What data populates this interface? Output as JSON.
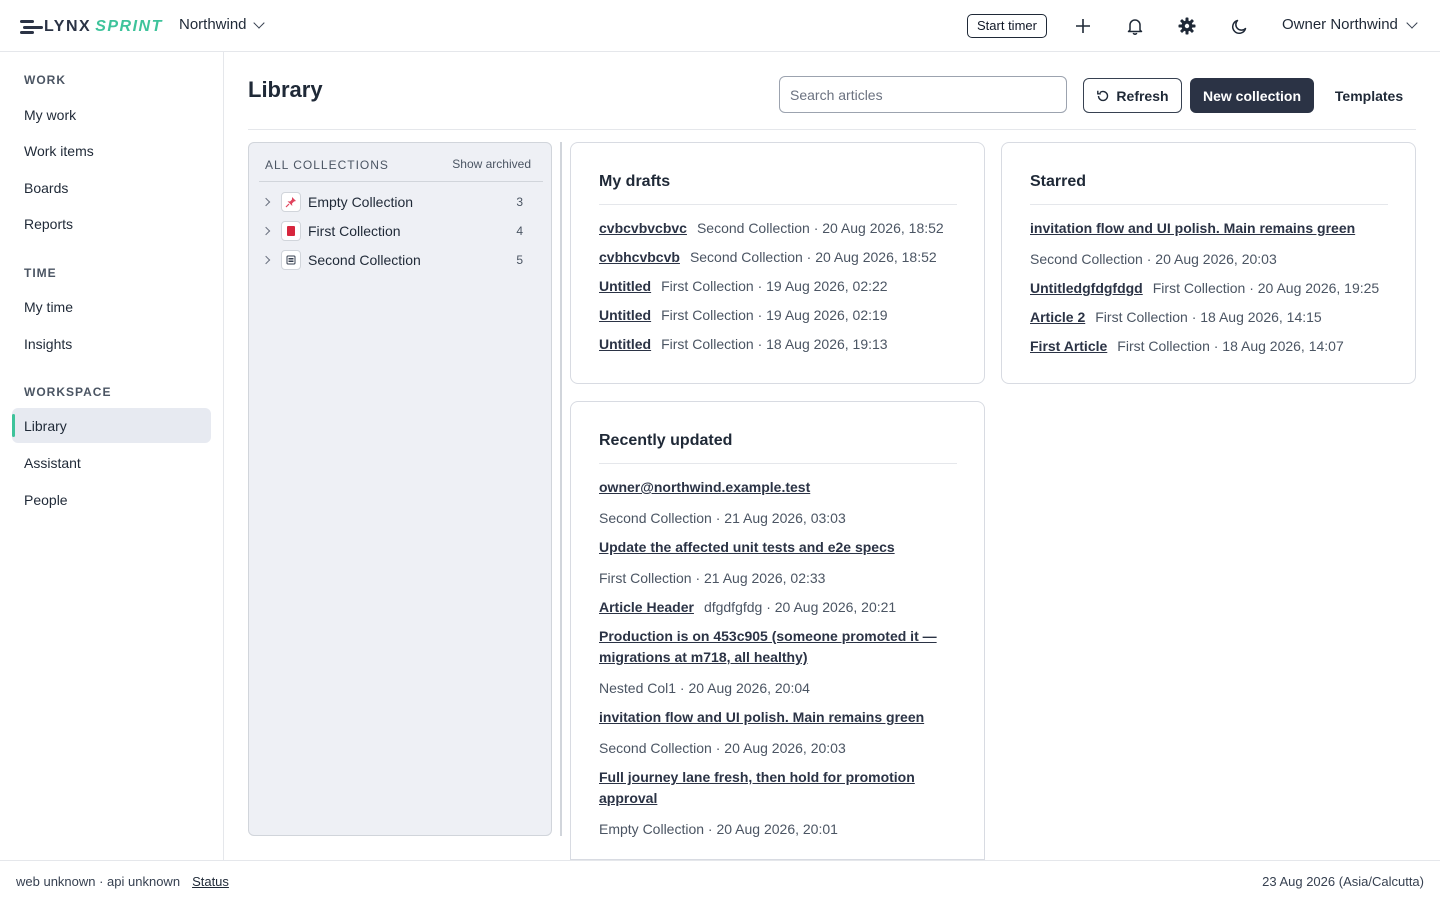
{
  "brand": {
    "name_a": "LYNX",
    "name_b": "SPRINT",
    "accent": "#3ec39b",
    "primary": "#2b3345"
  },
  "header": {
    "org": "Northwind",
    "start_timer": "Start timer",
    "icons": [
      "plus-icon",
      "bell-icon",
      "gear-icon",
      "moon-icon"
    ],
    "user": "Owner Northwind"
  },
  "sidebar": {
    "sections": [
      {
        "title": "WORK",
        "items": [
          "My work",
          "Work items",
          "Boards",
          "Reports"
        ]
      },
      {
        "title": "TIME",
        "items": [
          "My time",
          "Insights"
        ]
      },
      {
        "title": "WORKSPACE",
        "items": [
          "Library",
          "Assistant",
          "People"
        ]
      }
    ],
    "active": "Library"
  },
  "library": {
    "title": "Library",
    "search_placeholder": "Search articles",
    "refresh": "Refresh",
    "new_collection": "New collection",
    "templates": "Templates"
  },
  "collections": {
    "heading": "ALL COLLECTIONS",
    "show_archived": "Show archived",
    "items": [
      {
        "name": "Empty Collection",
        "count": "3",
        "icon": "pin-icon"
      },
      {
        "name": "First Collection",
        "count": "4",
        "icon": "book-icon"
      },
      {
        "name": "Second Collection",
        "count": "5",
        "icon": "list-icon"
      }
    ]
  },
  "drafts": {
    "title": "My drafts",
    "items": [
      {
        "title": "cvbcvbvcbvc",
        "meta": "Second Collection · 20 Aug 2026, 18:52"
      },
      {
        "title": "cvbhcvbcvb",
        "meta": "Second Collection · 20 Aug 2026, 18:52"
      },
      {
        "title": "Untitled",
        "meta": "First Collection · 19 Aug 2026, 02:22"
      },
      {
        "title": "Untitled",
        "meta": "First Collection · 19 Aug 2026, 02:19"
      },
      {
        "title": "Untitled",
        "meta": "First Collection · 18 Aug 2026, 19:13"
      }
    ]
  },
  "starred": {
    "title": "Starred",
    "items": [
      {
        "title": "invitation flow and UI polish. Main remains green",
        "meta": "Second Collection · 20 Aug 2026, 20:03"
      },
      {
        "title": "Untitledgfdgfdgd",
        "meta": "First Collection · 20 Aug 2026, 19:25"
      },
      {
        "title": "Article 2",
        "meta": "First Collection · 18 Aug 2026, 14:15"
      },
      {
        "title": "First Article",
        "meta": "First Collection · 18 Aug 2026, 14:07"
      }
    ]
  },
  "recent": {
    "title": "Recently updated",
    "items": [
      {
        "title": "owner@northwind.example.test",
        "meta": "Second Collection · 21 Aug 2026, 03:03"
      },
      {
        "title": "Update the affected unit tests and e2e specs",
        "meta": "First Collection · 21 Aug 2026, 02:33"
      },
      {
        "title": "Article Header",
        "meta": "dfgdfgfdg · 20 Aug 2026, 20:21"
      },
      {
        "title": "Production is on 453c905 (someone promoted it — migrations at m718, all healthy)",
        "meta": "Nested Col1 · 20 Aug 2026, 20:04"
      },
      {
        "title": "invitation flow and UI polish. Main remains green",
        "meta": "Second Collection · 20 Aug 2026, 20:03"
      },
      {
        "title": "Full journey lane fresh, then hold for promotion approval",
        "meta": "Empty Collection · 20 Aug 2026, 20:01"
      }
    ]
  },
  "footer": {
    "versions": "web unknown · api unknown",
    "status": "Status",
    "date": "23 Aug 2026 (Asia/Calcutta)"
  }
}
